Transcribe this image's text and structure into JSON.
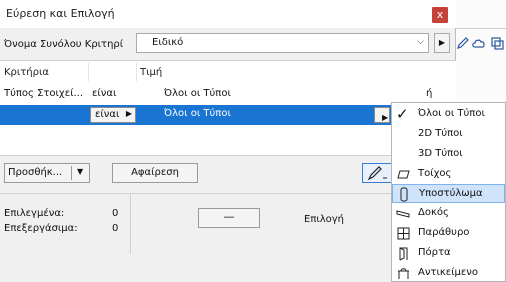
{
  "window": {
    "title": "Εύρεση και Επιλογή",
    "close_label": "x"
  },
  "criteria_set": {
    "label": "Όνομα Συνόλου Κριτηρί",
    "value": "Ειδικό"
  },
  "list": {
    "headers": {
      "criteria": "Κριτήρια",
      "value": "Τιμή"
    },
    "row1": {
      "criterion": "Τύπος Στοιχεί...",
      "operator": "είναι",
      "value": "Όλοι οι Τύποι",
      "trailing": "ή"
    },
    "row2": {
      "operator": "είναι",
      "value": "Όλοι οι Τύποι"
    }
  },
  "toolbar": {
    "add_label": "Προσθήκ...",
    "remove_label": "Αφαίρεση"
  },
  "stats": {
    "selected_label": "Επιλεγμένα:",
    "selected_value": "0",
    "editable_label": "Επεξεργάσιμα:",
    "editable_value": "0"
  },
  "selection": {
    "minus_label": "—",
    "select_label": "Επιλογή"
  },
  "popup": {
    "items": [
      {
        "label": "Όλοι οι Τύποι",
        "checked": true
      },
      {
        "label": "2D Τύποι"
      },
      {
        "label": "3D Τύποι"
      },
      {
        "label": "Τοίχος",
        "icon": "wall-icon"
      },
      {
        "label": "Υποστύλωμα",
        "icon": "column-icon",
        "highlighted": true
      },
      {
        "label": "Δοκός",
        "icon": "beam-icon"
      },
      {
        "label": "Παράθυρο",
        "icon": "window-icon"
      },
      {
        "label": "Πόρτα",
        "icon": "door-icon"
      },
      {
        "label": "Αντικείμενο",
        "icon": "object-icon"
      }
    ]
  },
  "colors": {
    "selection": "#1a75d2",
    "highlight": "#cfe3fb",
    "close": "#c4423a"
  }
}
